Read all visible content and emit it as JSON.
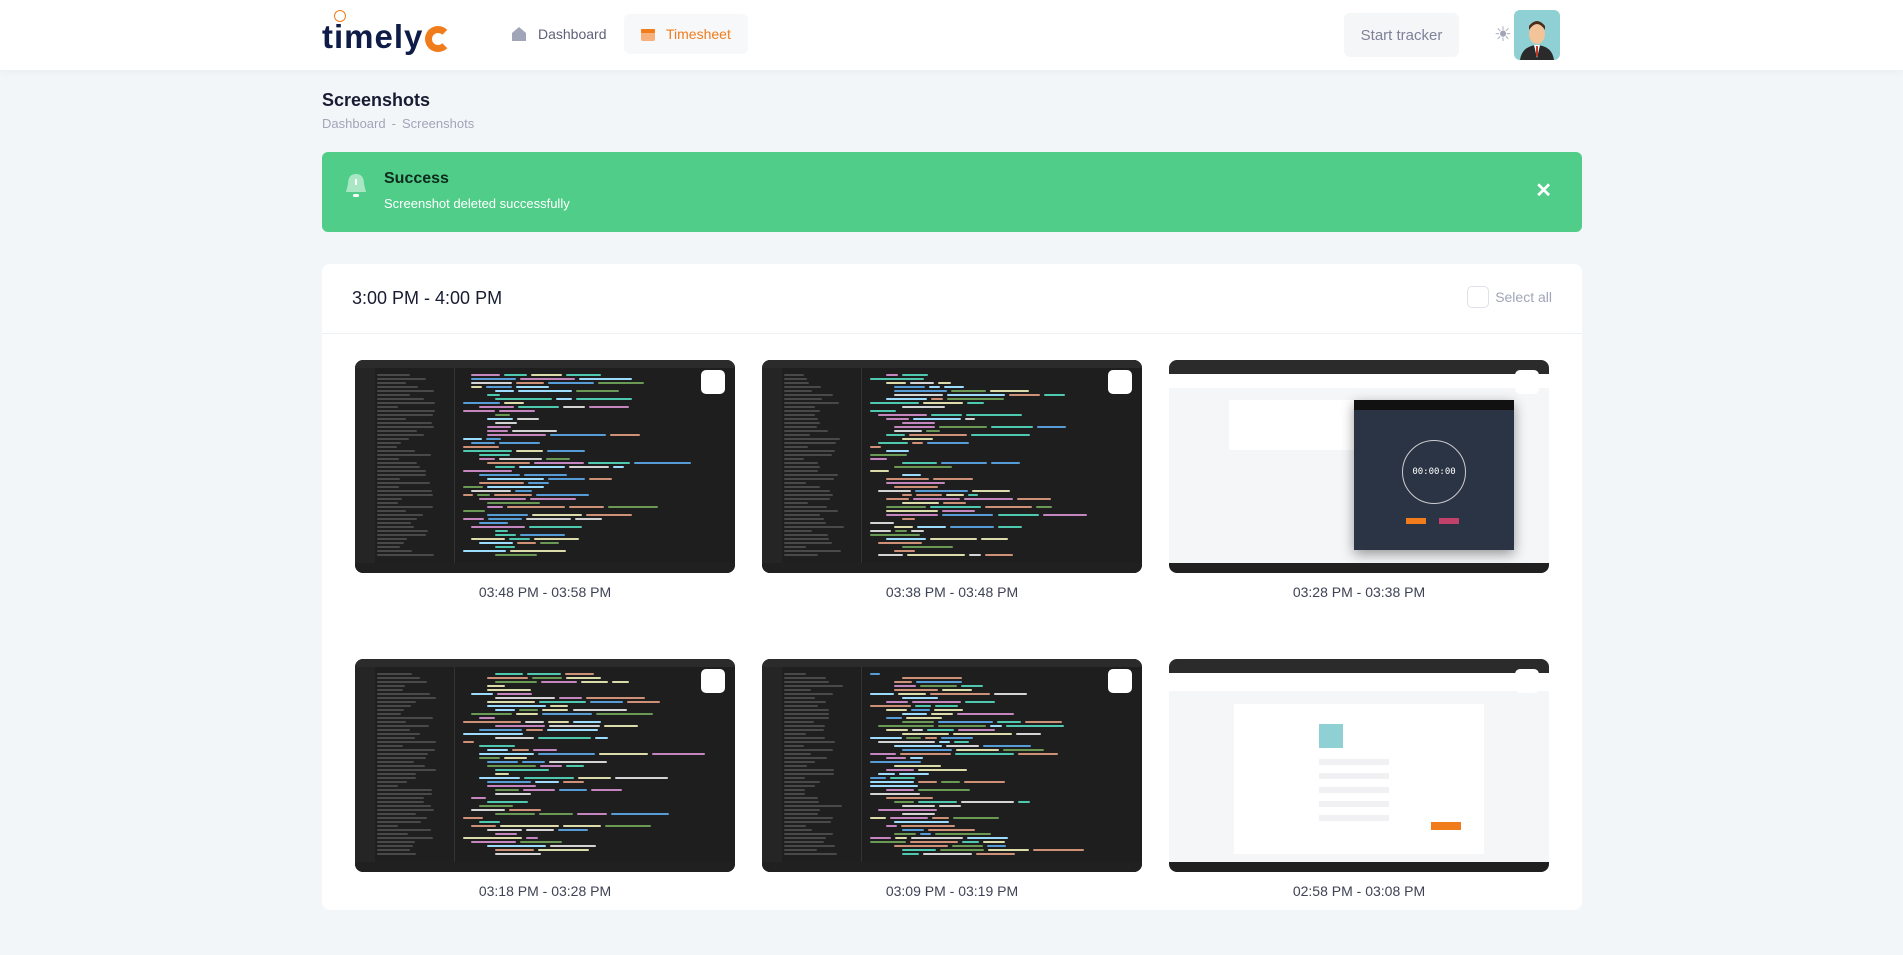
{
  "header": {
    "logo": "timely",
    "nav": [
      {
        "label": "Dashboard",
        "icon": "home-icon"
      },
      {
        "label": "Timesheet",
        "icon": "calendar-icon",
        "active": true
      }
    ],
    "start_tracker_label": "Start tracker",
    "accent": "#f07c1b"
  },
  "page": {
    "title": "Screenshots",
    "breadcrumb": [
      "Dashboard",
      "-",
      "Screenshots"
    ]
  },
  "alert": {
    "title": "Success",
    "message": "Screenshot deleted successfully",
    "color": "#50cd89"
  },
  "card": {
    "title": "3:00 PM - 4:00 PM",
    "select_all_label": "Select all",
    "screenshots": [
      {
        "time": "03:48 PM - 03:58 PM",
        "kind": "code"
      },
      {
        "time": "03:38 PM - 03:48 PM",
        "kind": "code"
      },
      {
        "time": "03:28 PM - 03:38 PM",
        "kind": "timer",
        "timer_text": "00:00:00"
      },
      {
        "time": "03:18 PM - 03:28 PM",
        "kind": "code"
      },
      {
        "time": "03:09 PM - 03:19 PM",
        "kind": "code"
      },
      {
        "time": "02:58 PM - 03:08 PM",
        "kind": "profile"
      }
    ]
  }
}
